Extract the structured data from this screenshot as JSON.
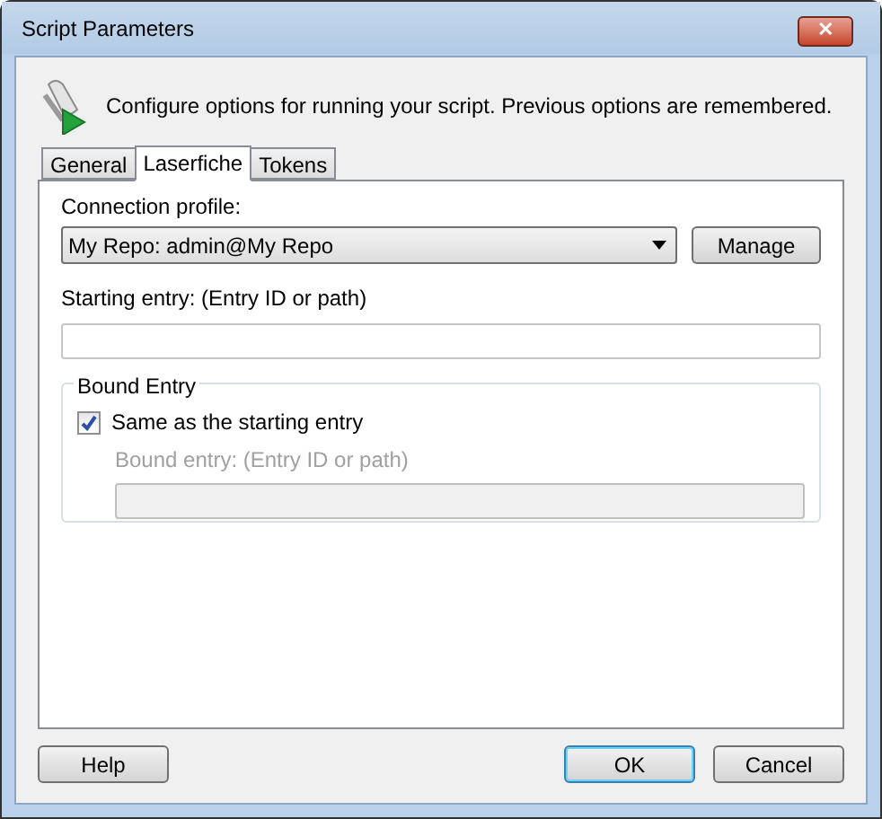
{
  "window": {
    "title": "Script Parameters",
    "close": "✕"
  },
  "header": {
    "text": "Configure options for running your script. Previous options are remembered."
  },
  "tabs": [
    {
      "label": "General",
      "selected": false
    },
    {
      "label": "Laserfiche",
      "selected": true
    },
    {
      "label": "Tokens",
      "selected": false
    }
  ],
  "connection_profile": {
    "label": "Connection profile:",
    "value": "My Repo: admin@My Repo",
    "button": "Manage"
  },
  "starting_entry": {
    "label": "Starting entry: (Entry ID or path)"
  },
  "bound_entry": {
    "title": "Bound Entry",
    "checkbox": {
      "label": "Same as the starting entry",
      "checked": true
    },
    "field": {
      "label": "Bound entry: (Entry ID or path)",
      "disabled": true
    }
  },
  "buttons": [
    {
      "label": "Help",
      "default": false
    },
    {
      "label": "OK",
      "default": true
    },
    {
      "label": "Cancel",
      "default": false
    }
  ]
}
